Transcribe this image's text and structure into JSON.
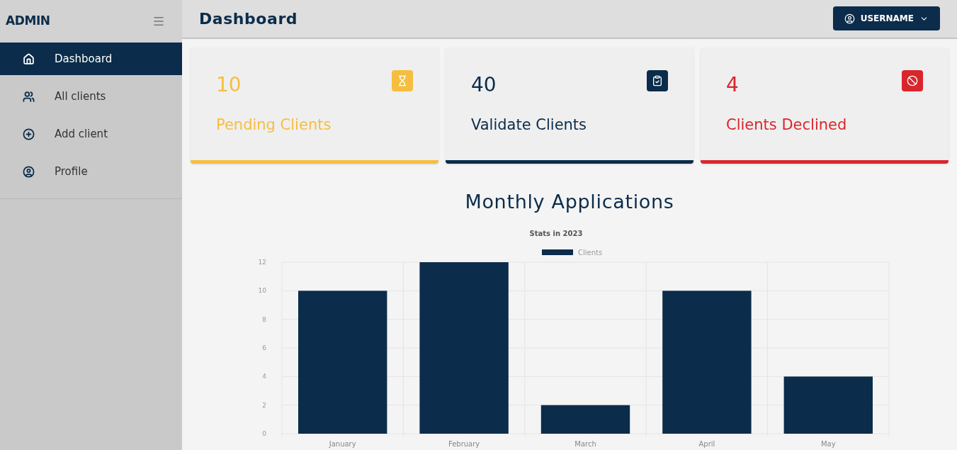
{
  "sidebar": {
    "title": "ADMIN",
    "items": [
      {
        "label": "Dashboard",
        "selected": true
      },
      {
        "label": "All clients",
        "selected": false
      },
      {
        "label": "Add client",
        "selected": false
      },
      {
        "label": "Profile",
        "selected": false
      }
    ]
  },
  "header": {
    "title": "Dashboard",
    "user_button": "USERNAME"
  },
  "cards": [
    {
      "count": "10",
      "label": "Pending Clients",
      "color": "#f6be3f"
    },
    {
      "count": "40",
      "label": "Validate Clients",
      "color": "#0b2c4a"
    },
    {
      "count": "4",
      "label": "Clients Declined",
      "color": "#d9262c"
    }
  ],
  "section_title": "Monthly Applications",
  "chart_data": {
    "type": "bar",
    "title": "Stats in 2023",
    "categories": [
      "January",
      "February",
      "March",
      "April",
      "May"
    ],
    "series": [
      {
        "name": "Clients",
        "color": "#0b2c4a",
        "values": [
          10,
          12,
          2,
          10,
          4
        ]
      }
    ],
    "ylim": [
      0,
      12
    ],
    "grid": true,
    "yticks": [
      0,
      2,
      4,
      6,
      8,
      10,
      12
    ]
  }
}
